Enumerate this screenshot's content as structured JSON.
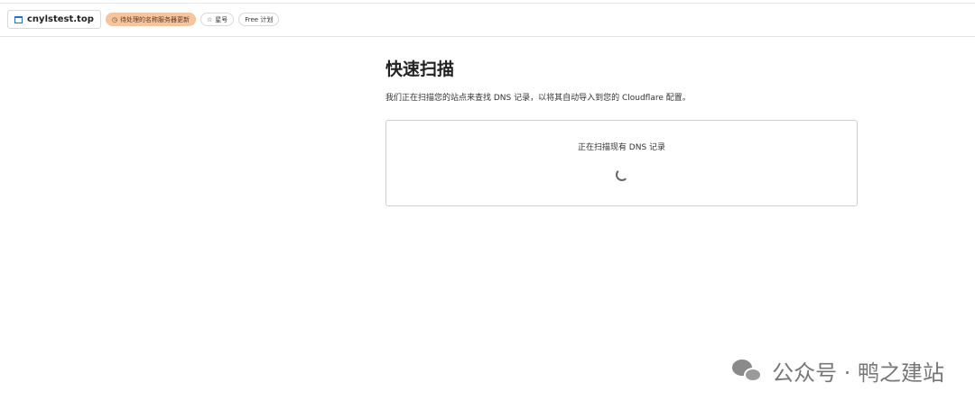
{
  "header": {
    "domain": "cnylstest.top",
    "status_badge": "待处理的名称服务器更新",
    "star_label": "星号",
    "plan_badge": "Free 计划"
  },
  "main": {
    "title": "快速扫描",
    "description": "我们正在扫描您的站点来查找 DNS 记录，以将其自动导入到您的 Cloudflare 配置。",
    "scan_message": "正在扫描现有 DNS 记录"
  },
  "watermark": {
    "text": "公众号 · 鸭之建站"
  }
}
